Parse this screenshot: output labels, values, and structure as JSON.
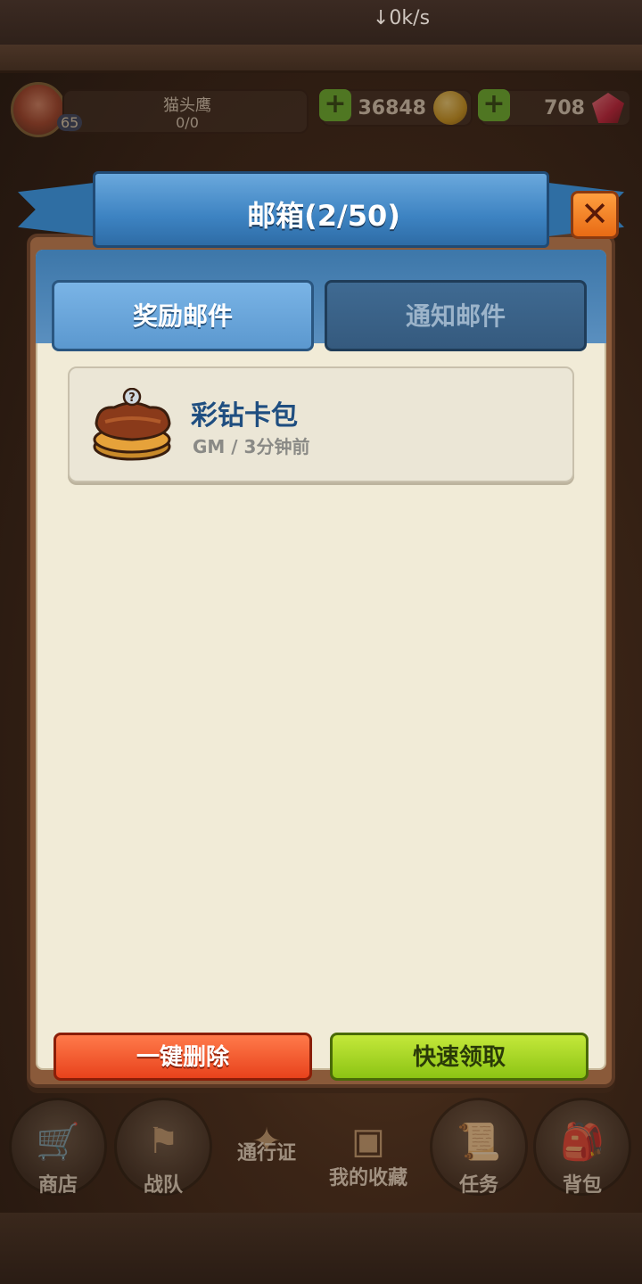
{
  "status_bar": {
    "speed": "↓0k/s"
  },
  "hud": {
    "level": "65",
    "player_name": "猫头鹰",
    "exp": "0/0",
    "coins": "36848",
    "gems": "708"
  },
  "dialog": {
    "title": "邮箱(2/50)",
    "close_label": "✕",
    "tabs": [
      {
        "label": "奖励邮件",
        "active": true
      },
      {
        "label": "通知邮件",
        "active": false
      }
    ],
    "mails": [
      {
        "title": "彩钻卡包",
        "subtitle": "GM / 3分钟前",
        "icon": "card-pack-icon"
      }
    ],
    "buttons": {
      "delete_all": "一键删除",
      "quick_claim": "快速领取"
    }
  },
  "bottom_nav": [
    {
      "label": "商店",
      "icon": "shop-icon"
    },
    {
      "label": "战队",
      "icon": "team-banner-icon"
    },
    {
      "label": "通行证",
      "icon": "pass-icon"
    },
    {
      "label": "我的收藏",
      "icon": "collection-book-icon"
    },
    {
      "label": "任务",
      "icon": "quest-scroll-icon"
    },
    {
      "label": "背包",
      "icon": "backpack-icon"
    }
  ],
  "colors": {
    "ribbon_blue": "#3d83c2",
    "panel_parchment": "#f1ebd7",
    "delete_red": "#e8421c",
    "claim_green": "#8cc414",
    "close_orange": "#e86a14"
  }
}
